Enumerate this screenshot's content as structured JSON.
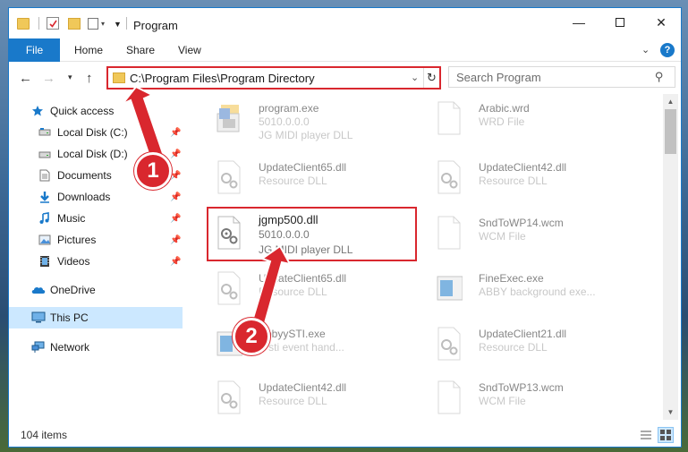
{
  "window": {
    "title": "Program"
  },
  "ribbon": {
    "tabs": [
      "File",
      "Home",
      "Share",
      "View"
    ]
  },
  "address": {
    "path": "C:\\Program Files\\Program Directory"
  },
  "search": {
    "placeholder": "Search Program"
  },
  "sidebar": {
    "items": [
      {
        "label": "Quick access",
        "icon": "star-icon",
        "pinned": false
      },
      {
        "label": "Local Disk (C:)",
        "icon": "drive-icon",
        "pinned": true
      },
      {
        "label": "Local Disk (D:)",
        "icon": "drive-icon",
        "pinned": true
      },
      {
        "label": "Documents",
        "icon": "documents-icon",
        "pinned": true
      },
      {
        "label": "Downloads",
        "icon": "download-icon",
        "pinned": true
      },
      {
        "label": "Music",
        "icon": "music-icon",
        "pinned": true
      },
      {
        "label": "Pictures",
        "icon": "pictures-icon",
        "pinned": true
      },
      {
        "label": "Videos",
        "icon": "videos-icon",
        "pinned": true
      },
      {
        "label": "OneDrive",
        "icon": "cloud-icon",
        "pinned": false
      },
      {
        "label": "This PC",
        "icon": "computer-icon",
        "pinned": false,
        "selected": true
      },
      {
        "label": "Network",
        "icon": "network-icon",
        "pinned": false
      }
    ]
  },
  "files": [
    {
      "name": "program.exe",
      "line2": "5010.0.0.0",
      "line3": "JG MIDI player DLL",
      "icon": "exe-icon"
    },
    {
      "name": "Arabic.wrd",
      "line2": "WRD File",
      "line3": "",
      "icon": "document-icon"
    },
    {
      "name": "UpdateClient65.dll",
      "line2": "Resource DLL",
      "line3": "",
      "icon": "dll-gear-icon"
    },
    {
      "name": "UpdateClient42.dll",
      "line2": "Resource DLL",
      "line3": "",
      "icon": "dll-gear-icon"
    },
    {
      "name": "jgmp500.dll",
      "line2": "5010.0.0.0",
      "line3": "JG MIDI player DLL",
      "icon": "dll-gear-icon",
      "highlighted": true
    },
    {
      "name": "SndToWP14.wcm",
      "line2": "WCM File",
      "line3": "",
      "icon": "document-icon"
    },
    {
      "name": "UpdateClient65.dll",
      "line2": "Resource DLL",
      "line3": "",
      "icon": "dll-gear-icon"
    },
    {
      "name": "FineExec.exe",
      "line2": "ABBY background exe...",
      "line3": "",
      "icon": "exe-window-icon"
    },
    {
      "name": "AbbyySTI.exe",
      "line2": "Y sti event hand...",
      "line3": "",
      "icon": "exe-window-icon"
    },
    {
      "name": "UpdateClient21.dll",
      "line2": "Resource DLL",
      "line3": "",
      "icon": "dll-gear-icon"
    },
    {
      "name": "UpdateClient42.dll",
      "line2": "Resource DLL",
      "line3": "",
      "icon": "dll-gear-icon"
    },
    {
      "name": "SndToWP13.wcm",
      "line2": "WCM File",
      "line3": "",
      "icon": "document-icon"
    }
  ],
  "status": {
    "item_count": "104 items"
  },
  "annotations": {
    "step1": "1",
    "step2": "2"
  },
  "colors": {
    "accent": "#1979ca",
    "highlight": "#d9272e",
    "selected_bg": "#cce8ff"
  }
}
